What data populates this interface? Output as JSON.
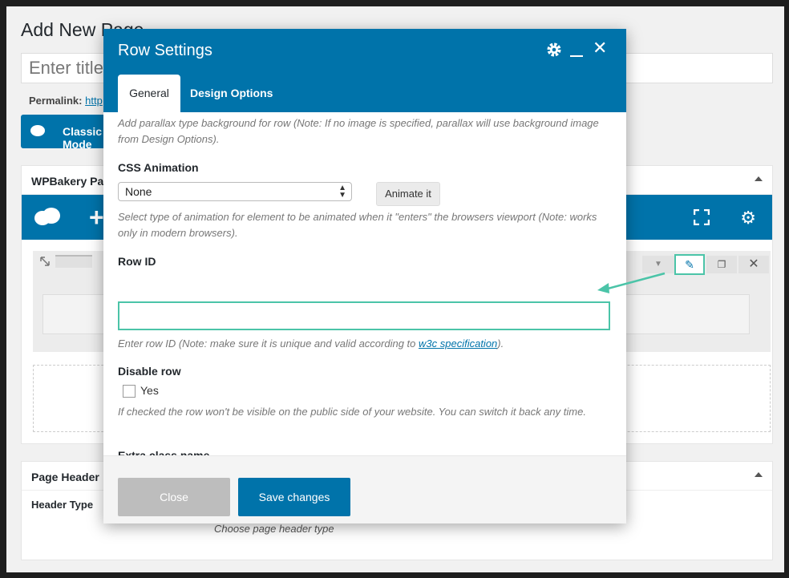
{
  "page": {
    "title": "Add New Page",
    "title_placeholder": "Enter title here",
    "permalink_label": "Permalink:",
    "permalink_link": "http",
    "classic_button": "Classic Mode"
  },
  "wpbakery_box": {
    "title": "WPBakery Page Builder"
  },
  "page_header_box": {
    "title": "Page Header",
    "header_type_label": "Header Type",
    "header_type_help": "Choose page header type"
  },
  "modal": {
    "title": "Row Settings",
    "tabs": [
      {
        "label": "General",
        "active": true
      },
      {
        "label": "Design Options",
        "active": false
      }
    ],
    "parallax_help": "Add parallax type background for row (Note: If no image is specified, parallax will use background image from Design Options).",
    "css_animation": {
      "label": "CSS Animation",
      "selected": "None",
      "button": "Animate it",
      "help": "Select type of animation for element to be animated when it \"enters\" the browsers viewport (Note: works only in modern browsers)."
    },
    "row_id": {
      "label": "Row ID",
      "value": "",
      "help_before": "Enter row ID (Note: make sure it is unique and valid according to ",
      "help_link": "w3c specification",
      "help_after": ")."
    },
    "disable_row": {
      "label": "Disable row",
      "checkbox_label": "Yes",
      "checked": false,
      "help": "If checked the row won't be visible on the public side of your website. You can switch it back any time."
    },
    "extra_class": {
      "label": "Extra class name",
      "value": ""
    },
    "footer": {
      "close": "Close",
      "save": "Save changes"
    }
  },
  "colors": {
    "brand": "#0073aa",
    "highlight": "#4bc4a8",
    "close_button": "#bdbdbd"
  }
}
